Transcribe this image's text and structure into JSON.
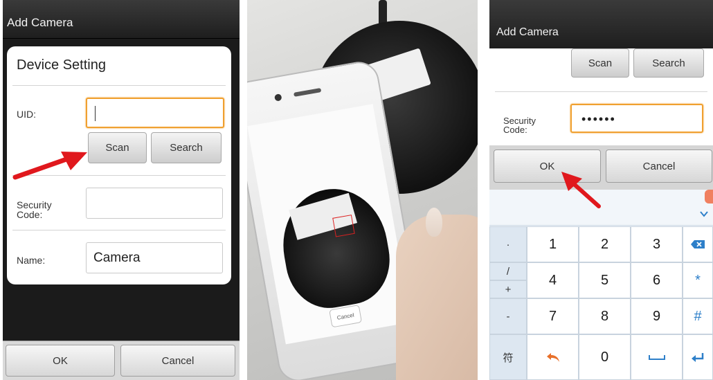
{
  "panel1": {
    "title": "Add Camera",
    "dialog_title": "Device Setting",
    "uid_label": "UID:",
    "uid_value": "",
    "scan_label": "Scan",
    "search_label": "Search",
    "security_label": "Security\nCode:",
    "security_value": "",
    "name_label": "Name:",
    "name_value": "Camera",
    "ok_label": "OK",
    "cancel_label": "Cancel"
  },
  "panel2": {
    "cancel_label": "Cancel"
  },
  "panel3": {
    "title": "Add Camera",
    "scan_label": "Scan",
    "search_label": "Search",
    "security_label": "Security\nCode:",
    "security_value": "••••••",
    "ok_label": "OK",
    "cancel_label": "Cancel",
    "keys": {
      "dot": "·",
      "slash": "/",
      "plus": "+",
      "minus": "-",
      "fu": "符",
      "k1": "1",
      "k2": "2",
      "k3": "3",
      "k4": "4",
      "k5": "5",
      "k6": "6",
      "k7": "7",
      "k8": "8",
      "k9": "9",
      "k0": "0",
      "star": "*",
      "hash": "#"
    }
  },
  "colors": {
    "focus_orange": "#f0a030",
    "arrow_red": "#e0181d",
    "key_accent": "#2d7fc9"
  }
}
